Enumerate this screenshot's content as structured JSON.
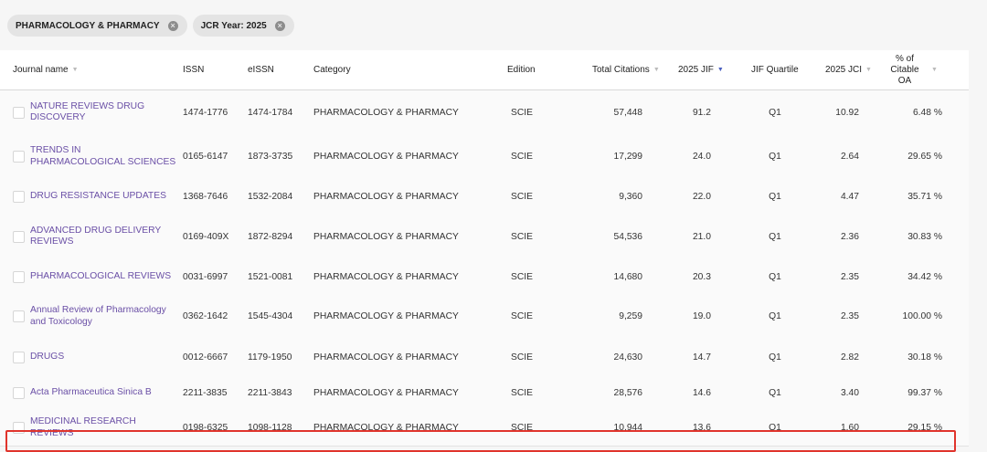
{
  "filters": [
    {
      "label": "PHARMACOLOGY & PHARMACY",
      "remove_icon": "close-circle-icon"
    },
    {
      "label": "JCR Year: 2025",
      "remove_icon": "close-circle-icon"
    }
  ],
  "columns": {
    "journal": "Journal name",
    "issn": "ISSN",
    "eissn": "eISSN",
    "category": "Category",
    "edition": "Edition",
    "citations": "Total Citations",
    "jif": "2025 JIF",
    "quartile": "JIF Quartile",
    "jci": "2025 JCI",
    "oa": "% of Citable OA"
  },
  "sorted_column": "2025 JIF",
  "highlighted_row": "Acta Pharmaceutica Sinica B",
  "highlight_color": "#e0342c",
  "link_color": "#6a4fa6",
  "rows": [
    {
      "name": "NATURE REVIEWS DRUG DISCOVERY",
      "issn": "1474-1776",
      "eissn": "1474-1784",
      "category": "PHARMACOLOGY & PHARMACY",
      "edition": "SCIE",
      "citations": "57,448",
      "jif": "91.2",
      "quartile": "Q1",
      "jci": "10.92",
      "oa": "6.48 %"
    },
    {
      "name": "TRENDS IN PHARMACOLOGICAL SCIENCES",
      "issn": "0165-6147",
      "eissn": "1873-3735",
      "category": "PHARMACOLOGY & PHARMACY",
      "edition": "SCIE",
      "citations": "17,299",
      "jif": "24.0",
      "quartile": "Q1",
      "jci": "2.64",
      "oa": "29.65 %"
    },
    {
      "name": "DRUG RESISTANCE UPDATES",
      "issn": "1368-7646",
      "eissn": "1532-2084",
      "category": "PHARMACOLOGY & PHARMACY",
      "edition": "SCIE",
      "citations": "9,360",
      "jif": "22.0",
      "quartile": "Q1",
      "jci": "4.47",
      "oa": "35.71 %"
    },
    {
      "name": "ADVANCED DRUG DELIVERY REVIEWS",
      "issn": "0169-409X",
      "eissn": "1872-8294",
      "category": "PHARMACOLOGY & PHARMACY",
      "edition": "SCIE",
      "citations": "54,536",
      "jif": "21.0",
      "quartile": "Q1",
      "jci": "2.36",
      "oa": "30.83 %"
    },
    {
      "name": "PHARMACOLOGICAL REVIEWS",
      "issn": "0031-6997",
      "eissn": "1521-0081",
      "category": "PHARMACOLOGY & PHARMACY",
      "edition": "SCIE",
      "citations": "14,680",
      "jif": "20.3",
      "quartile": "Q1",
      "jci": "2.35",
      "oa": "34.42 %"
    },
    {
      "name": "Annual Review of Pharmacology and Toxicology",
      "issn": "0362-1642",
      "eissn": "1545-4304",
      "category": "PHARMACOLOGY & PHARMACY",
      "edition": "SCIE",
      "citations": "9,259",
      "jif": "19.0",
      "quartile": "Q1",
      "jci": "2.35",
      "oa": "100.00 %"
    },
    {
      "name": "DRUGS",
      "issn": "0012-6667",
      "eissn": "1179-1950",
      "category": "PHARMACOLOGY & PHARMACY",
      "edition": "SCIE",
      "citations": "24,630",
      "jif": "14.7",
      "quartile": "Q1",
      "jci": "2.82",
      "oa": "30.18 %"
    },
    {
      "name": "Acta Pharmaceutica Sinica B",
      "issn": "2211-3835",
      "eissn": "2211-3843",
      "category": "PHARMACOLOGY & PHARMACY",
      "edition": "SCIE",
      "citations": "28,576",
      "jif": "14.6",
      "quartile": "Q1",
      "jci": "3.40",
      "oa": "99.37 %"
    },
    {
      "name": "MEDICINAL RESEARCH REVIEWS",
      "issn": "0198-6325",
      "eissn": "1098-1128",
      "category": "PHARMACOLOGY & PHARMACY",
      "edition": "SCIE",
      "citations": "10,944",
      "jif": "13.6",
      "quartile": "Q1",
      "jci": "1.60",
      "oa": "29.15 %"
    }
  ]
}
